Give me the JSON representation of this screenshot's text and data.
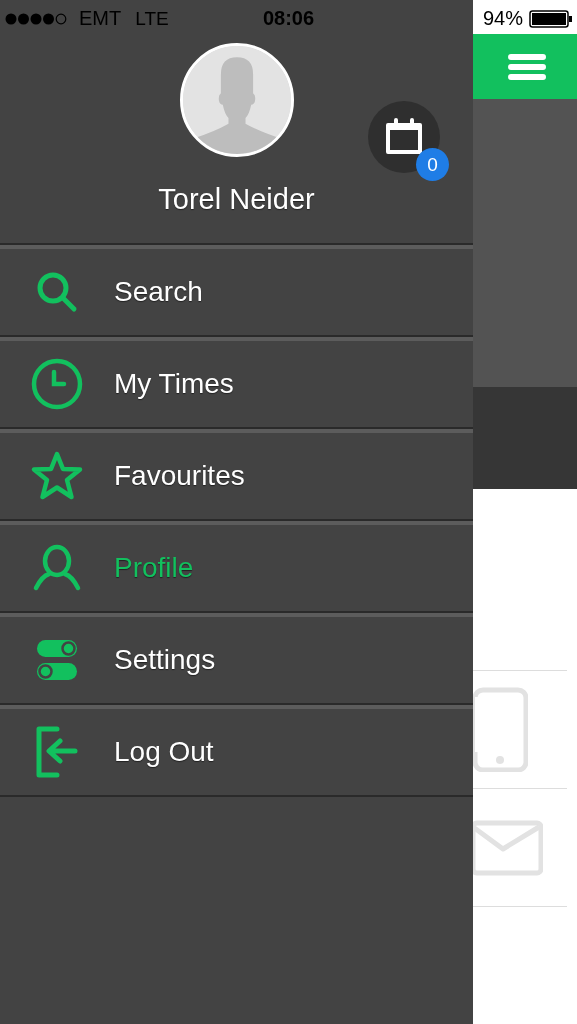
{
  "status_bar": {
    "carrier": "EMT",
    "network": "LTE",
    "time": "08:06",
    "battery": "94%"
  },
  "profile": {
    "name": "Torel Neider",
    "calendar_badge": "0"
  },
  "menu": [
    {
      "label": "Search",
      "kind": "search",
      "selected": false
    },
    {
      "label": "My Times",
      "kind": "clock",
      "selected": false
    },
    {
      "label": "Favourites",
      "kind": "star",
      "selected": false
    },
    {
      "label": "Profile",
      "kind": "person",
      "selected": true
    },
    {
      "label": "Settings",
      "kind": "toggles",
      "selected": false
    },
    {
      "label": "Log Out",
      "kind": "logout",
      "selected": false
    }
  ]
}
